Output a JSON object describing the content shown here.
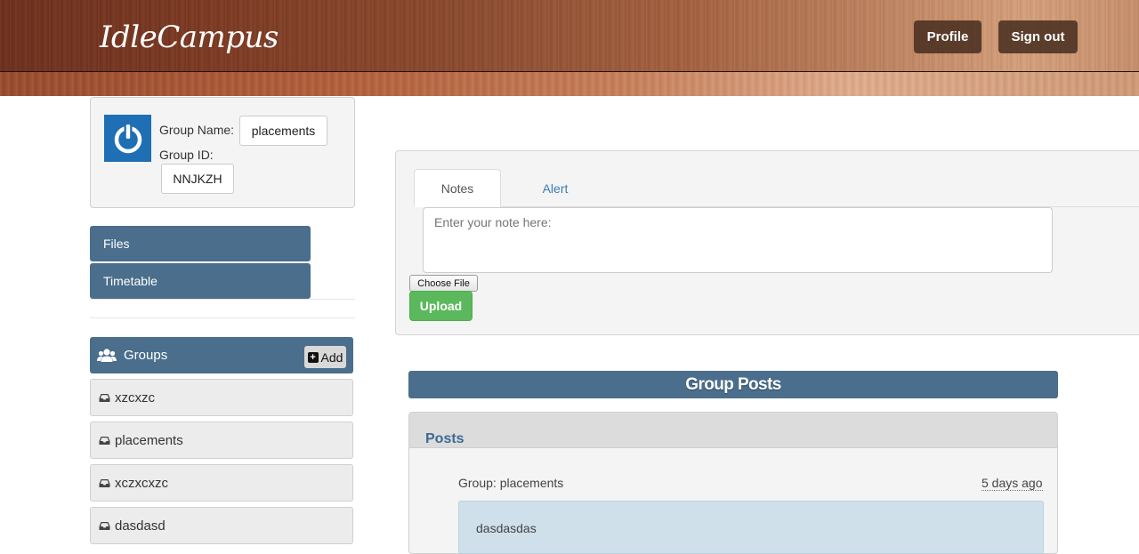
{
  "header": {
    "logo": "IdleCampus",
    "logo_dot": ".",
    "profile_label": "Profile",
    "signout_label": "Sign out"
  },
  "group_card": {
    "name_label": "Group Name:",
    "name_value": "placements",
    "id_label": "Group ID:",
    "id_value": "NNJKZH"
  },
  "nav": {
    "files": "Files",
    "timetable": "Timetable"
  },
  "groups": {
    "title": "Groups",
    "add_label": "Add",
    "items": [
      {
        "label": "xzcxzc"
      },
      {
        "label": "placements"
      },
      {
        "label": "xczxcxzc"
      },
      {
        "label": "dasdasd"
      }
    ]
  },
  "compose": {
    "tabs": [
      {
        "label": "Notes"
      },
      {
        "label": "Alert"
      }
    ],
    "note_placeholder": "Enter your note here:",
    "choose_file_label": "Choose File",
    "upload_label": "Upload"
  },
  "group_posts": {
    "heading": "Group Posts",
    "panel_title": "Posts",
    "post": {
      "group": "Group: placements",
      "time": "5 days ago",
      "body": "dasdasdas"
    }
  },
  "colors": {
    "accent": "#4a6e8c",
    "success": "#5cb85c",
    "link": "#3a7bb8"
  }
}
